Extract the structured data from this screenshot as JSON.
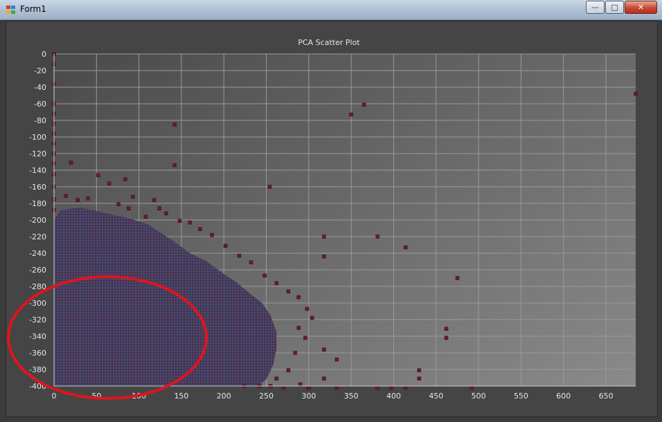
{
  "window": {
    "title": "Form1",
    "controls": {
      "minimize": "—",
      "maximize": "□",
      "close": "✕"
    },
    "icon": "form-app-icon"
  },
  "chart_data": {
    "type": "scatter",
    "title": "PCA Scatter Plot",
    "xlabel": "",
    "ylabel": "",
    "xlim": [
      0,
      685
    ],
    "ylim": [
      -400,
      0
    ],
    "x_ticks": [
      0,
      50,
      100,
      150,
      200,
      250,
      300,
      350,
      400,
      450,
      500,
      550,
      600,
      650
    ],
    "y_ticks": [
      0,
      -20,
      -40,
      -60,
      -80,
      -100,
      -120,
      -140,
      -160,
      -180,
      -200,
      -220,
      -240,
      -260,
      -280,
      -300,
      -320,
      -340,
      -360,
      -380,
      -400
    ],
    "grid": true,
    "marker_color": "#6b1a30",
    "dense_fill_color": "#3b4a6e",
    "series": [
      {
        "points": [
          [
            0,
            0
          ],
          [
            0,
            -12
          ],
          [
            0,
            -36
          ],
          [
            0,
            -60
          ],
          [
            0,
            -72
          ],
          [
            0,
            -84
          ],
          [
            0,
            -96
          ],
          [
            0,
            -108
          ],
          [
            0,
            -120
          ],
          [
            0,
            -132
          ],
          [
            0,
            -145
          ],
          [
            0,
            -160
          ],
          [
            0,
            -175
          ],
          [
            0,
            -188
          ],
          [
            20,
            -131
          ],
          [
            52,
            -146
          ],
          [
            65,
            -156
          ],
          [
            84,
            -151
          ],
          [
            93,
            -172
          ],
          [
            142,
            -85
          ],
          [
            142,
            -134
          ],
          [
            254,
            -160
          ],
          [
            350,
            -73
          ],
          [
            365,
            -61
          ],
          [
            685,
            -48
          ],
          [
            318,
            -220
          ],
          [
            318,
            -244
          ],
          [
            381,
            -220
          ],
          [
            414,
            -233
          ],
          [
            475,
            -270
          ],
          [
            462,
            -331
          ],
          [
            462,
            -342
          ],
          [
            430,
            -381
          ],
          [
            430,
            -391
          ],
          [
            318,
            -356
          ],
          [
            333,
            -368
          ],
          [
            318,
            -391
          ],
          [
            333,
            -402
          ],
          [
            381,
            -402
          ],
          [
            397,
            -402
          ],
          [
            414,
            -402
          ],
          [
            492,
            -402
          ],
          [
            270,
            -402
          ],
          [
            290,
            -398
          ],
          [
            300,
            -402
          ],
          [
            14,
            -171
          ],
          [
            28,
            -176
          ],
          [
            40,
            -174
          ],
          [
            76,
            -181
          ],
          [
            88,
            -186
          ],
          [
            108,
            -196
          ],
          [
            118,
            -176
          ],
          [
            124,
            -186
          ],
          [
            132,
            -192
          ],
          [
            148,
            -201
          ],
          [
            160,
            -203
          ],
          [
            172,
            -211
          ],
          [
            186,
            -218
          ],
          [
            202,
            -231
          ],
          [
            218,
            -243
          ],
          [
            232,
            -251
          ],
          [
            248,
            -267
          ],
          [
            262,
            -276
          ],
          [
            276,
            -286
          ],
          [
            288,
            -293
          ],
          [
            298,
            -307
          ],
          [
            304,
            -318
          ],
          [
            288,
            -330
          ],
          [
            296,
            -342
          ],
          [
            284,
            -360
          ],
          [
            276,
            -381
          ],
          [
            262,
            -391
          ],
          [
            255,
            -400
          ],
          [
            242,
            -400
          ],
          [
            224,
            -400
          ]
        ]
      }
    ],
    "dense_region_outline": [
      [
        0,
        -200
      ],
      [
        8,
        -188
      ],
      [
        30,
        -185
      ],
      [
        55,
        -190
      ],
      [
        75,
        -195
      ],
      [
        95,
        -200
      ],
      [
        110,
        -205
      ],
      [
        125,
        -215
      ],
      [
        140,
        -225
      ],
      [
        160,
        -240
      ],
      [
        180,
        -250
      ],
      [
        200,
        -265
      ],
      [
        215,
        -275
      ],
      [
        230,
        -288
      ],
      [
        245,
        -300
      ],
      [
        255,
        -315
      ],
      [
        262,
        -335
      ],
      [
        262,
        -355
      ],
      [
        258,
        -375
      ],
      [
        250,
        -392
      ],
      [
        240,
        -400
      ],
      [
        0,
        -400
      ]
    ]
  },
  "annotation": {
    "name": "red-ellipse-highlight",
    "color": "#e0141e"
  }
}
